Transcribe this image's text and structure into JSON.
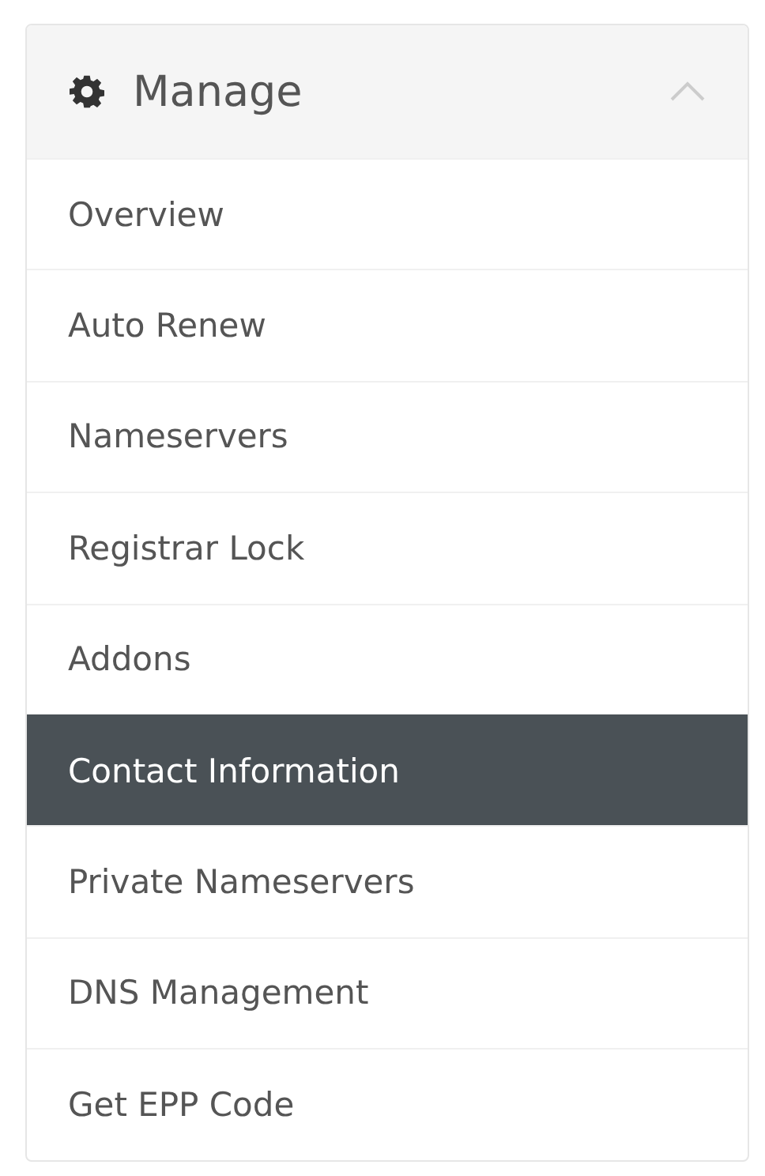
{
  "panel": {
    "title": "Manage",
    "expanded": true,
    "items": [
      {
        "label": "Overview",
        "selected": false
      },
      {
        "label": "Auto Renew",
        "selected": false
      },
      {
        "label": "Nameservers",
        "selected": false
      },
      {
        "label": "Registrar Lock",
        "selected": false
      },
      {
        "label": "Addons",
        "selected": false
      },
      {
        "label": "Contact Information",
        "selected": true
      },
      {
        "label": "Private Nameservers",
        "selected": false
      },
      {
        "label": "DNS Management",
        "selected": false
      },
      {
        "label": "Get EPP Code",
        "selected": false
      }
    ]
  }
}
